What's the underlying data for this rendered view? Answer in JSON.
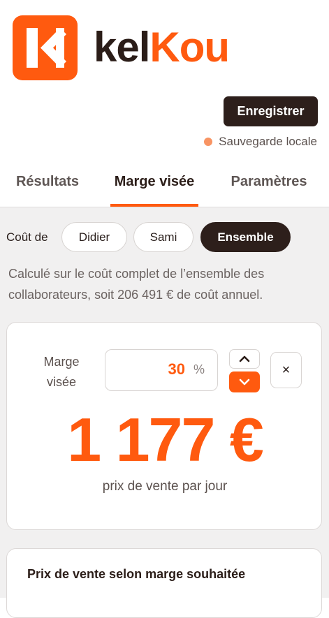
{
  "brand": {
    "logo_text_dark": "kel",
    "logo_text_accent": "Kou",
    "accent": "#ff5a0f",
    "dark": "#2d1f1b"
  },
  "toolbar": {
    "save_label": "Enregistrer",
    "status_text": "Sauvegarde locale",
    "status_color": "#f89463"
  },
  "tabs": [
    {
      "label": "Résultats",
      "active": false
    },
    {
      "label": "Marge visée",
      "active": true
    },
    {
      "label": "Paramètres",
      "active": false
    }
  ],
  "cost_filter": {
    "label": "Coût de",
    "options": [
      {
        "label": "Didier",
        "selected": false
      },
      {
        "label": "Sami",
        "selected": false
      },
      {
        "label": "Ensemble",
        "selected": true
      }
    ]
  },
  "description": "Calculé sur le coût complet de l’ensemble des collaborateurs, soit 206 491 € de coût annuel.",
  "margin": {
    "label": "Marge visée",
    "value": "30",
    "unit": "%",
    "icons": {
      "increment": "chevron-up-icon",
      "decrement": "chevron-down-icon",
      "clear": "close-icon"
    },
    "clear_label": "×"
  },
  "result": {
    "price": "1 177 €",
    "caption": "prix de vente par jour"
  },
  "table_card": {
    "title": "Prix de vente selon marge souhaitée"
  }
}
